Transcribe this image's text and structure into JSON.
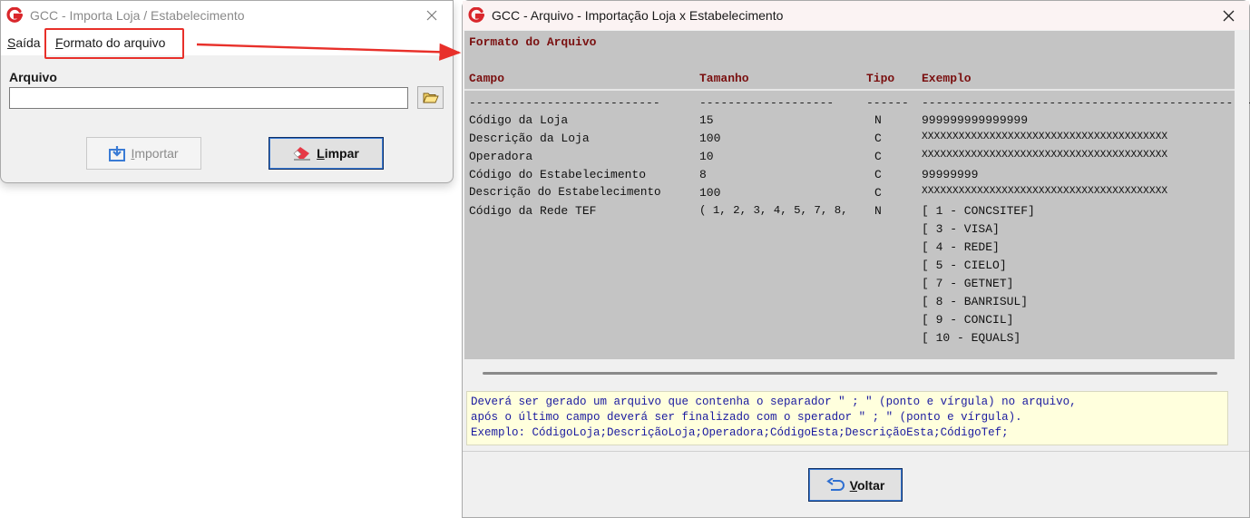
{
  "left_window": {
    "title": "GCC - Importa Loja / Estabelecimento",
    "menu": {
      "exit_label_underlined": "S",
      "exit_label_rest": "aída",
      "format_label_underlined": "F",
      "format_label_rest": "ormato do arquivo"
    },
    "file_label": "Arquivo",
    "file_value": "",
    "import_label_underlined": "I",
    "import_label_rest": "mportar",
    "clear_label_underlined": "L",
    "clear_label_rest": "impar"
  },
  "right_window": {
    "title": "GCC - Arquivo - Importação Loja x Estabelecimento",
    "format_title": "Formato do Arquivo",
    "columns": [
      "Campo",
      "Tamanho",
      "Tipo",
      "Exemplo"
    ],
    "separators": [
      "---------------------------",
      "-------------------",
      "------",
      "-------------------------------------------------"
    ],
    "rows": [
      {
        "campo": "Código da Loja",
        "tamanho": "15",
        "tipo": "N",
        "exemplo": "999999999999999"
      },
      {
        "campo": "Descrição da Loja",
        "tamanho": "100",
        "tipo": "C",
        "exemplo": "XXXXXXXXXXXXXXXXXXXXXXXXXXXXXXXXXXXXXXXX"
      },
      {
        "campo": "Operadora",
        "tamanho": "10",
        "tipo": "C",
        "exemplo": "XXXXXXXXXXXXXXXXXXXXXXXXXXXXXXXXXXXXXXXX"
      },
      {
        "campo": "Código do Estabelecimento",
        "tamanho": "8",
        "tipo": "C",
        "exemplo": "99999999"
      },
      {
        "campo": "Descrição do Estabelecimento",
        "tamanho": "100",
        "tipo": "C",
        "exemplo": "XXXXXXXXXXXXXXXXXXXXXXXXXXXXXXXXXXXXXXXX"
      },
      {
        "campo": "Código da Rede TEF",
        "tamanho": "( 1, 2, 3, 4, 5, 7, 8,",
        "tipo": "N",
        "exemplo": "[ 1 - CONCSITEF]"
      }
    ],
    "extra_examples": [
      "[ 3 - VISA]",
      "[ 4 - REDE]",
      "[ 5 - CIELO]",
      "[ 7 - GETNET]",
      "[ 8 - BANRISUL]",
      "[ 9 - CONCIL]",
      "[ 10 - EQUALS]"
    ],
    "note_lines": [
      "Deverá ser gerado um arquivo que contenha o separador \" ; \" (ponto e vírgula) no arquivo,",
      "após o último campo deverá ser finalizado com o sperador \" ; \" (ponto e vírgula).",
      "Exemplo: CódigoLoja;DescriçãoLoja;Operadora;CódigoEsta;DescriçãoEsta;CódigoTef;"
    ],
    "back_label_underlined": "V",
    "back_label_rest": "oltar"
  },
  "colors": {
    "header_text": "#7a1010",
    "panel_bg": "#c4c4c4",
    "note_bg": "#ffffdd",
    "note_text": "#1a1aa0",
    "highlight": "#e8302a",
    "logo": "#d9262b"
  },
  "icons": [
    "gcc-logo-icon",
    "close-icon",
    "folder-open-icon",
    "import-icon",
    "eraser-icon",
    "back-arrow-icon"
  ]
}
